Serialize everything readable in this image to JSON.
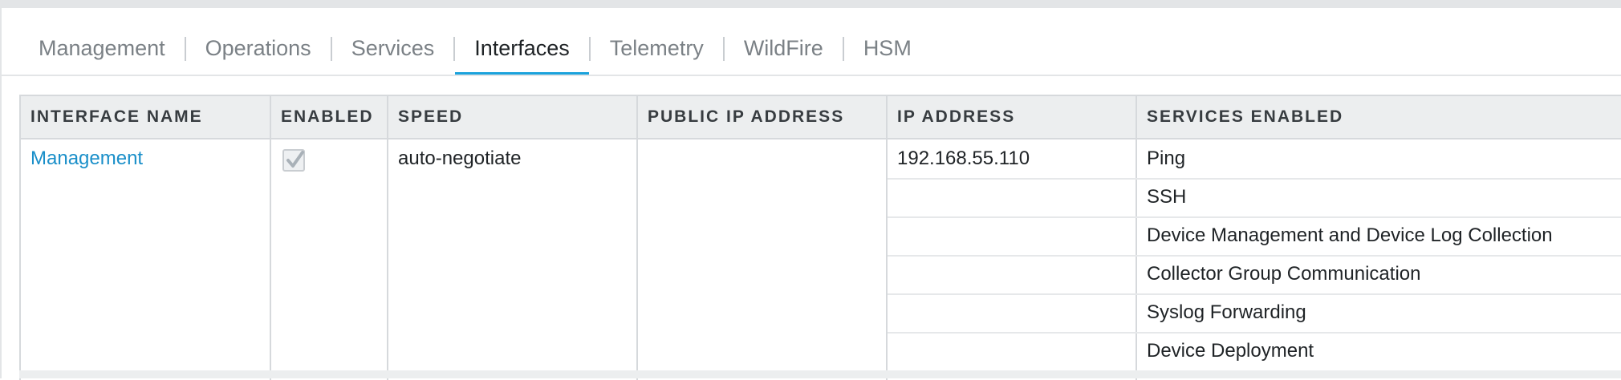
{
  "tabs": [
    {
      "label": "Management"
    },
    {
      "label": "Operations"
    },
    {
      "label": "Services"
    },
    {
      "label": "Interfaces",
      "active": true
    },
    {
      "label": "Telemetry"
    },
    {
      "label": "WildFire"
    },
    {
      "label": "HSM"
    }
  ],
  "table": {
    "columns": [
      "INTERFACE NAME",
      "ENABLED",
      "SPEED",
      "PUBLIC IP ADDRESS",
      "IP ADDRESS",
      "SERVICES ENABLED"
    ],
    "row": {
      "interface_name": "Management",
      "enabled": true,
      "speed": "auto-negotiate",
      "public_ip": "",
      "ip_address": "192.168.55.110",
      "services": [
        "Ping",
        "SSH",
        "Device Management and Device Log Collection",
        "Collector Group Communication",
        "Syslog Forwarding",
        "Device Deployment"
      ]
    }
  },
  "colors": {
    "accent": "#1aa2dc",
    "link": "#1a8fc9",
    "header_bg": "#eceeef"
  }
}
